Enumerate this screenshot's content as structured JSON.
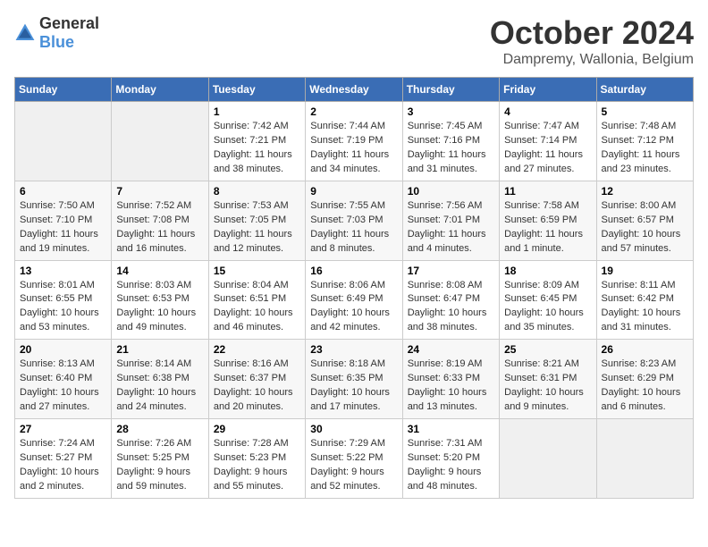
{
  "header": {
    "logo_general": "General",
    "logo_blue": "Blue",
    "month": "October 2024",
    "location": "Dampremy, Wallonia, Belgium"
  },
  "days_of_week": [
    "Sunday",
    "Monday",
    "Tuesday",
    "Wednesday",
    "Thursday",
    "Friday",
    "Saturday"
  ],
  "weeks": [
    [
      {
        "day": "",
        "info": ""
      },
      {
        "day": "",
        "info": ""
      },
      {
        "day": "1",
        "info": "Sunrise: 7:42 AM\nSunset: 7:21 PM\nDaylight: 11 hours and 38 minutes."
      },
      {
        "day": "2",
        "info": "Sunrise: 7:44 AM\nSunset: 7:19 PM\nDaylight: 11 hours and 34 minutes."
      },
      {
        "day": "3",
        "info": "Sunrise: 7:45 AM\nSunset: 7:16 PM\nDaylight: 11 hours and 31 minutes."
      },
      {
        "day": "4",
        "info": "Sunrise: 7:47 AM\nSunset: 7:14 PM\nDaylight: 11 hours and 27 minutes."
      },
      {
        "day": "5",
        "info": "Sunrise: 7:48 AM\nSunset: 7:12 PM\nDaylight: 11 hours and 23 minutes."
      }
    ],
    [
      {
        "day": "6",
        "info": "Sunrise: 7:50 AM\nSunset: 7:10 PM\nDaylight: 11 hours and 19 minutes."
      },
      {
        "day": "7",
        "info": "Sunrise: 7:52 AM\nSunset: 7:08 PM\nDaylight: 11 hours and 16 minutes."
      },
      {
        "day": "8",
        "info": "Sunrise: 7:53 AM\nSunset: 7:05 PM\nDaylight: 11 hours and 12 minutes."
      },
      {
        "day": "9",
        "info": "Sunrise: 7:55 AM\nSunset: 7:03 PM\nDaylight: 11 hours and 8 minutes."
      },
      {
        "day": "10",
        "info": "Sunrise: 7:56 AM\nSunset: 7:01 PM\nDaylight: 11 hours and 4 minutes."
      },
      {
        "day": "11",
        "info": "Sunrise: 7:58 AM\nSunset: 6:59 PM\nDaylight: 11 hours and 1 minute."
      },
      {
        "day": "12",
        "info": "Sunrise: 8:00 AM\nSunset: 6:57 PM\nDaylight: 10 hours and 57 minutes."
      }
    ],
    [
      {
        "day": "13",
        "info": "Sunrise: 8:01 AM\nSunset: 6:55 PM\nDaylight: 10 hours and 53 minutes."
      },
      {
        "day": "14",
        "info": "Sunrise: 8:03 AM\nSunset: 6:53 PM\nDaylight: 10 hours and 49 minutes."
      },
      {
        "day": "15",
        "info": "Sunrise: 8:04 AM\nSunset: 6:51 PM\nDaylight: 10 hours and 46 minutes."
      },
      {
        "day": "16",
        "info": "Sunrise: 8:06 AM\nSunset: 6:49 PM\nDaylight: 10 hours and 42 minutes."
      },
      {
        "day": "17",
        "info": "Sunrise: 8:08 AM\nSunset: 6:47 PM\nDaylight: 10 hours and 38 minutes."
      },
      {
        "day": "18",
        "info": "Sunrise: 8:09 AM\nSunset: 6:45 PM\nDaylight: 10 hours and 35 minutes."
      },
      {
        "day": "19",
        "info": "Sunrise: 8:11 AM\nSunset: 6:42 PM\nDaylight: 10 hours and 31 minutes."
      }
    ],
    [
      {
        "day": "20",
        "info": "Sunrise: 8:13 AM\nSunset: 6:40 PM\nDaylight: 10 hours and 27 minutes."
      },
      {
        "day": "21",
        "info": "Sunrise: 8:14 AM\nSunset: 6:38 PM\nDaylight: 10 hours and 24 minutes."
      },
      {
        "day": "22",
        "info": "Sunrise: 8:16 AM\nSunset: 6:37 PM\nDaylight: 10 hours and 20 minutes."
      },
      {
        "day": "23",
        "info": "Sunrise: 8:18 AM\nSunset: 6:35 PM\nDaylight: 10 hours and 17 minutes."
      },
      {
        "day": "24",
        "info": "Sunrise: 8:19 AM\nSunset: 6:33 PM\nDaylight: 10 hours and 13 minutes."
      },
      {
        "day": "25",
        "info": "Sunrise: 8:21 AM\nSunset: 6:31 PM\nDaylight: 10 hours and 9 minutes."
      },
      {
        "day": "26",
        "info": "Sunrise: 8:23 AM\nSunset: 6:29 PM\nDaylight: 10 hours and 6 minutes."
      }
    ],
    [
      {
        "day": "27",
        "info": "Sunrise: 7:24 AM\nSunset: 5:27 PM\nDaylight: 10 hours and 2 minutes."
      },
      {
        "day": "28",
        "info": "Sunrise: 7:26 AM\nSunset: 5:25 PM\nDaylight: 9 hours and 59 minutes."
      },
      {
        "day": "29",
        "info": "Sunrise: 7:28 AM\nSunset: 5:23 PM\nDaylight: 9 hours and 55 minutes."
      },
      {
        "day": "30",
        "info": "Sunrise: 7:29 AM\nSunset: 5:22 PM\nDaylight: 9 hours and 52 minutes."
      },
      {
        "day": "31",
        "info": "Sunrise: 7:31 AM\nSunset: 5:20 PM\nDaylight: 9 hours and 48 minutes."
      },
      {
        "day": "",
        "info": ""
      },
      {
        "day": "",
        "info": ""
      }
    ]
  ]
}
